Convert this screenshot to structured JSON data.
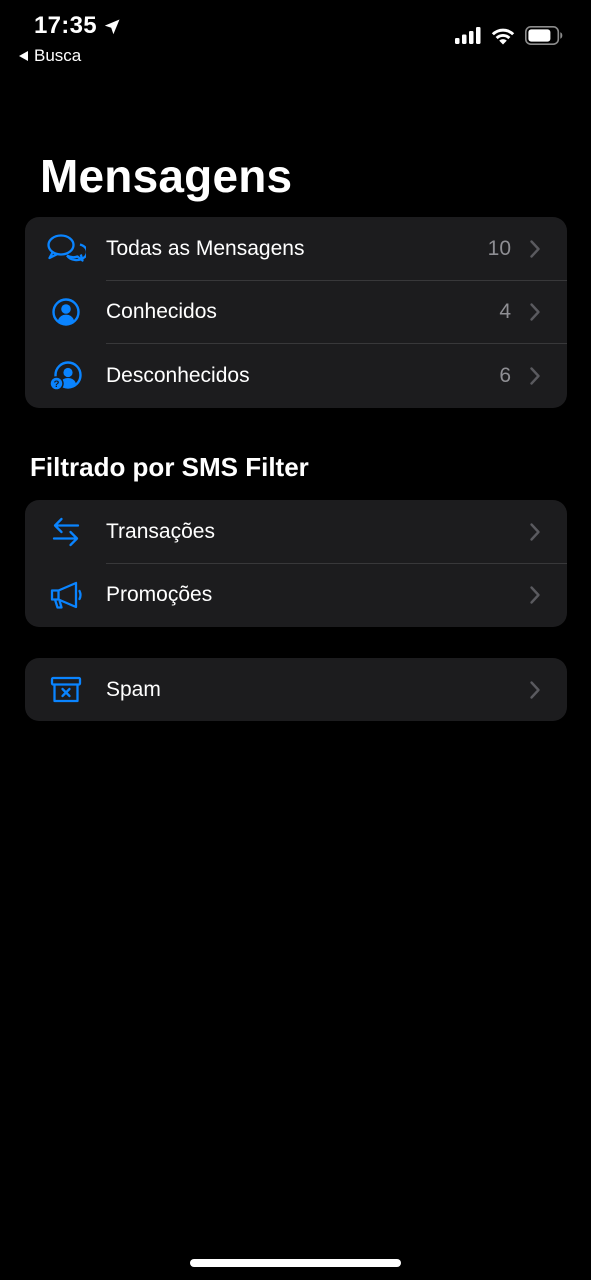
{
  "status_bar": {
    "time": "17:35",
    "back_label": "Busca"
  },
  "title": "Mensagens",
  "messages_group": {
    "items": [
      {
        "label": "Todas as Mensagens",
        "count": "10",
        "icon": "chat-bubbles-icon"
      },
      {
        "label": "Conhecidos",
        "count": "4",
        "icon": "person-circle-icon"
      },
      {
        "label": "Desconhecidos",
        "count": "6",
        "icon": "unknown-person-icon"
      }
    ]
  },
  "filter_section": {
    "header": "Filtrado por SMS Filter",
    "items": [
      {
        "label": "Transações",
        "icon": "arrows-exchange-icon"
      },
      {
        "label": "Promoções",
        "icon": "megaphone-icon"
      }
    ]
  },
  "spam_group": {
    "items": [
      {
        "label": "Spam",
        "icon": "junk-box-icon"
      }
    ]
  },
  "colors": {
    "background": "#000000",
    "group_background": "#1c1c1e",
    "accent": "#0a84ff",
    "secondary_text": "#8e8e93",
    "separator": "#38383a"
  }
}
